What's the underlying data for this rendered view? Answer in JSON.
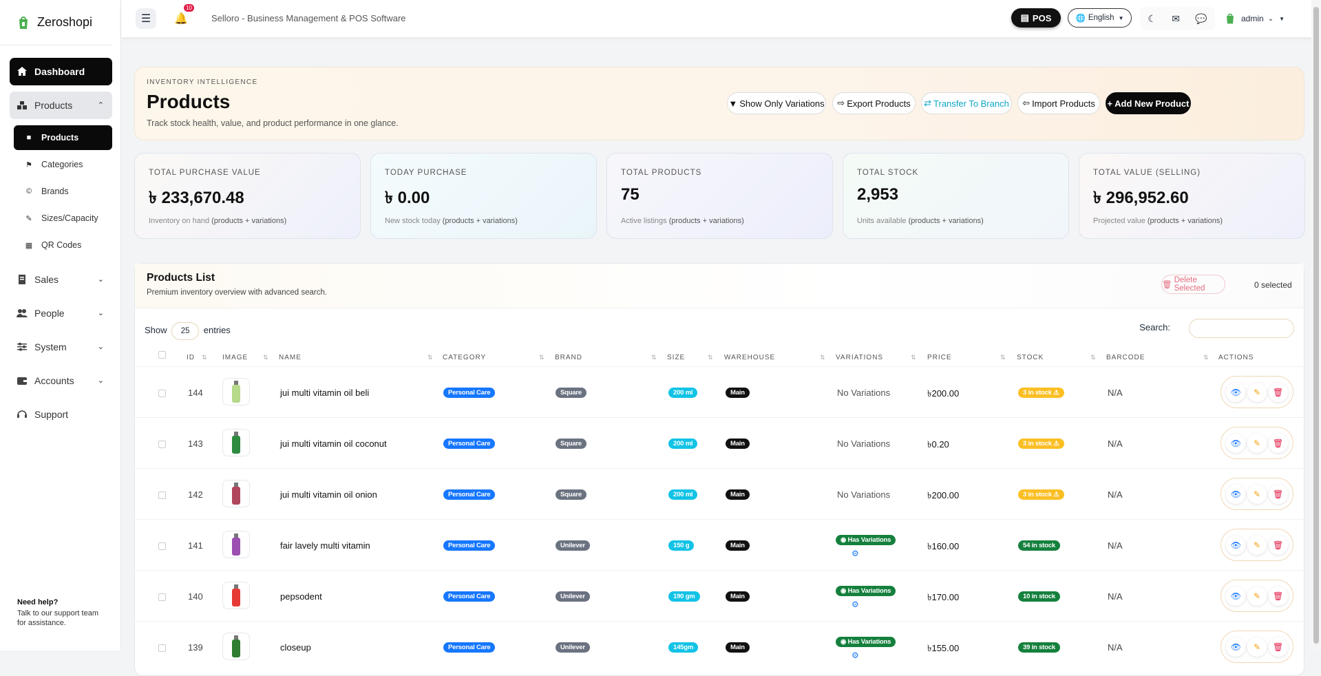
{
  "app": {
    "name": "Zeroshopi",
    "title": "Selloro - Business Management & POS Software"
  },
  "sidebar": {
    "dashboard": "Dashboard",
    "products_group": "Products",
    "products_sub": [
      {
        "label": "Products",
        "icon": "box-icon"
      },
      {
        "label": "Categories",
        "icon": "tag-icon"
      },
      {
        "label": "Brands",
        "icon": "copyright-icon"
      },
      {
        "label": "Sizes/Capacity",
        "icon": "ruler-icon"
      },
      {
        "label": "QR Codes",
        "icon": "qrcode-icon"
      }
    ],
    "sales": "Sales",
    "people": "People",
    "system": "System",
    "accounts": "Accounts",
    "support": "Support",
    "help_title": "Need help?",
    "help_text": "Talk to our support team for assistance."
  },
  "topbar": {
    "notifications": "10",
    "pos": "POS",
    "language": "English",
    "user": "admin"
  },
  "hero": {
    "kicker": "INVENTORY INTELLIGENCE",
    "title": "Products",
    "description": "Track stock health, value, and product performance in one glance.",
    "btn_variations": "Show Only Variations",
    "btn_export": "Export Products",
    "btn_transfer": "Transfer To Branch",
    "btn_import": "Import Products",
    "btn_add": "Add New Product"
  },
  "stats": [
    {
      "label": "TOTAL PURCHASE VALUE",
      "value": "৳ 233,670.48",
      "sub1": "Inventory on hand",
      "sub2": "(products + variations)"
    },
    {
      "label": "TODAY PURCHASE",
      "value": "৳ 0.00",
      "sub1": "New stock today",
      "sub2": "(products + variations)"
    },
    {
      "label": "TOTAL PRODUCTS",
      "value": "75",
      "sub1": "Active listings",
      "sub2": "(products + variations)"
    },
    {
      "label": "TOTAL STOCK",
      "value": "2,953",
      "sub1": "Units available",
      "sub2": "(products + variations)"
    },
    {
      "label": "TOTAL VALUE (SELLING)",
      "value": "৳ 296,952.60",
      "sub1": "Projected value",
      "sub2": "(products + variations)"
    }
  ],
  "list": {
    "title": "Products List",
    "description": "Premium inventory overview with advanced search.",
    "delete_selected": "Delete Selected",
    "selected_count": "0 selected",
    "show": "Show",
    "page_size": "25",
    "entries": "entries",
    "search_label": "Search:",
    "columns": [
      "ID",
      "IMAGE",
      "NAME",
      "CATEGORY",
      "BRAND",
      "SIZE",
      "WAREHOUSE",
      "VARIATIONS",
      "PRICE",
      "STOCK",
      "BARCODE",
      "ACTIONS"
    ],
    "rows": [
      {
        "id": "144",
        "name": "jui multi vitamin oil beli",
        "category": "Personal Care",
        "brand": "Square",
        "size": "200 ml",
        "warehouse": "Main",
        "variations": "No Variations",
        "price": "৳200.00",
        "stock": "3 in stock",
        "stock_status": "low",
        "barcode": "N/A"
      },
      {
        "id": "143",
        "name": "jui multi vitamin oil coconut",
        "category": "Personal Care",
        "brand": "Square",
        "size": "200 ml",
        "warehouse": "Main",
        "variations": "No Variations",
        "price": "৳0.20",
        "stock": "3 in stock",
        "stock_status": "low",
        "barcode": "N/A"
      },
      {
        "id": "142",
        "name": "jui multi vitamin oil onion",
        "category": "Personal Care",
        "brand": "Square",
        "size": "200 ml",
        "warehouse": "Main",
        "variations": "No Variations",
        "price": "৳200.00",
        "stock": "3 in stock",
        "stock_status": "low",
        "barcode": "N/A"
      },
      {
        "id": "141",
        "name": "fair lavely multi vitamin",
        "category": "Personal Care",
        "brand": "Unilever",
        "size": "150 g",
        "warehouse": "Main",
        "variations": "Has Variations",
        "price": "৳160.00",
        "stock": "54 in stock",
        "stock_status": "ok",
        "barcode": "N/A"
      },
      {
        "id": "140",
        "name": "pepsodent",
        "category": "Personal Care",
        "brand": "Unilever",
        "size": "190 gm",
        "warehouse": "Main",
        "variations": "Has Variations",
        "price": "৳170.00",
        "stock": "10 in stock",
        "stock_status": "ok",
        "barcode": "N/A"
      },
      {
        "id": "139",
        "name": "closeup",
        "category": "Personal Care",
        "brand": "Unilever",
        "size": "145gm",
        "warehouse": "Main",
        "variations": "Has Variations",
        "price": "৳155.00",
        "stock": "39 in stock",
        "stock_status": "ok",
        "barcode": "N/A"
      }
    ]
  }
}
